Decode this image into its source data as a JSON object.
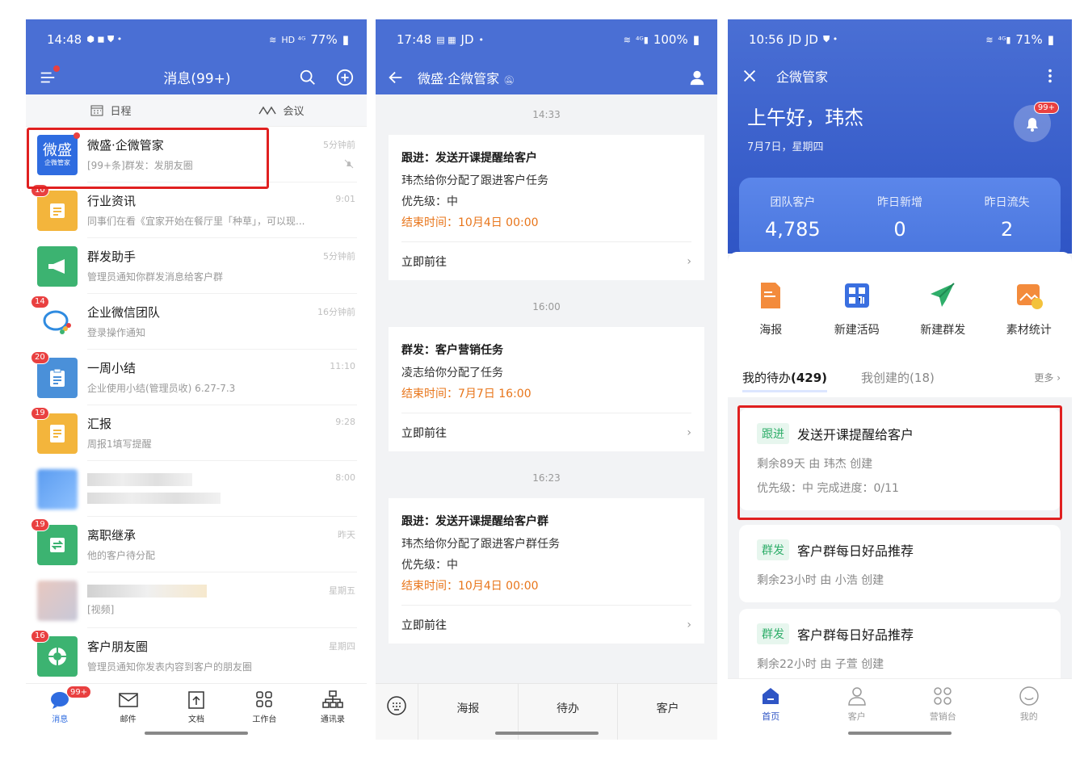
{
  "phone1": {
    "status": {
      "time": "14:48",
      "battery": "77%",
      "net": "HD ⁴ᴳ"
    },
    "nav": {
      "title": "消息(99+)"
    },
    "tabs": [
      {
        "label": "日程"
      },
      {
        "label": "会议"
      }
    ],
    "messages": [
      {
        "name": "微盛·企微管家",
        "sub": "[99+条]群发：发朋友圈",
        "time": "5分钟前",
        "avatar_line1": "微盛",
        "avatar_line2": "企微管家"
      },
      {
        "name": "行业资讯",
        "sub": "同事们在看《宜家开始在餐厅里「种草」，可以现...",
        "time": "9:01",
        "badge": "10"
      },
      {
        "name": "群发助手",
        "sub": "管理员通知你群发消息给客户群",
        "time": "5分钟前"
      },
      {
        "name": "企业微信团队",
        "sub": "登录操作通知",
        "time": "16分钟前",
        "badge": "14"
      },
      {
        "name": "一周小结",
        "sub": "企业使用小结(管理员收) 6.27-7.3",
        "time": "11:10",
        "badge": "20"
      },
      {
        "name": "汇报",
        "sub": "周报1填写提醒",
        "time": "9:28",
        "badge": "19"
      },
      {
        "name": "",
        "sub": "",
        "time": "8:00"
      },
      {
        "name": "离职继承",
        "sub": "他的客户待分配",
        "time": "昨天",
        "badge": "19"
      },
      {
        "name": "",
        "sub": "[视频]",
        "time": "星期五"
      },
      {
        "name": "客户朋友圈",
        "sub": "管理员通知你发表内容到客户的朋友圈",
        "time": "星期四",
        "badge": "16"
      }
    ],
    "bottom_nav": [
      {
        "label": "消息",
        "badge": "99+"
      },
      {
        "label": "邮件"
      },
      {
        "label": "文档"
      },
      {
        "label": "工作台"
      },
      {
        "label": "通讯录"
      }
    ]
  },
  "phone2": {
    "status": {
      "time": "17:48",
      "battery": "100%",
      "extra": "JD"
    },
    "nav": {
      "title": "微盛·企微管家"
    },
    "timestamps": [
      "14:33",
      "16:00",
      "16:23"
    ],
    "cards": [
      {
        "title": "跟进：发送开课提醒给客户",
        "line1": "玮杰给你分配了跟进客户任务",
        "line2": "优先级：中",
        "deadline": "结束时间：10月4日 00:00",
        "action": "立即前往"
      },
      {
        "title": "群发：客户营销任务",
        "line1": "凌志给你分配了任务",
        "line2": "",
        "deadline": "结束时间：7月7日 16:00",
        "action": "立即前往"
      },
      {
        "title": "跟进：发送开课提醒给客户群",
        "line1": "玮杰给你分配了跟进客户群任务",
        "line2": "优先级：中",
        "deadline": "结束时间：10月4日 00:00",
        "action": "立即前往"
      }
    ],
    "bottom_nav": [
      {
        "label": "海报"
      },
      {
        "label": "待办"
      },
      {
        "label": "客户"
      }
    ]
  },
  "phone3": {
    "status": {
      "time": "10:56",
      "battery": "71%",
      "extra": "JD JD"
    },
    "nav": {
      "title": "企微管家"
    },
    "greeting": "上午好，玮杰",
    "date": "7月7日，星期四",
    "bell_badge": "99+",
    "stats": [
      {
        "label": "团队客户",
        "value": "4,785"
      },
      {
        "label": "昨日新增",
        "value": "0"
      },
      {
        "label": "昨日流失",
        "value": "2"
      }
    ],
    "quick": [
      {
        "label": "海报"
      },
      {
        "label": "新建活码"
      },
      {
        "label": "新建群发"
      },
      {
        "label": "素材统计"
      }
    ],
    "todo_tabs": {
      "mine_prefix": "我的待办",
      "mine_count": "(429)",
      "created": "我创建的(18)",
      "more": "更多"
    },
    "todos": [
      {
        "tag": "跟进",
        "title": "发送开课提醒给客户",
        "line1": "剩余89天  由 玮杰 创建",
        "line2": "优先级：中    完成进度：0/11"
      },
      {
        "tag": "群发",
        "title": "客户群每日好品推荐",
        "line1": "剩余23小时  由 小浩 创建"
      },
      {
        "tag": "群发",
        "title": "客户群每日好品推荐",
        "line1": "剩余22小时  由 子萱 创建"
      }
    ],
    "bottom_nav": [
      {
        "label": "首页"
      },
      {
        "label": "客户"
      },
      {
        "label": "营销台"
      },
      {
        "label": "我的"
      }
    ]
  },
  "colors": {
    "brand_blue": "#4a6fd4",
    "highlight_red": "#e02020",
    "badge_red": "#e94040",
    "deadline_orange": "#e8751a",
    "tag_green": "#2fae6a"
  }
}
